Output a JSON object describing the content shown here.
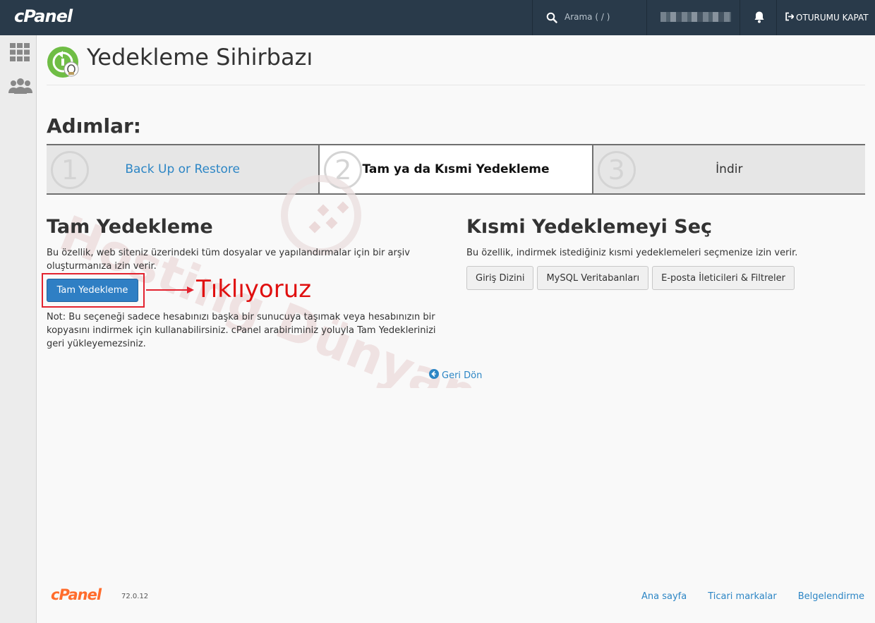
{
  "header": {
    "brand": "cPanel",
    "search_placeholder": "Arama ( / )",
    "logout_label": "OTURUMU KAPAT"
  },
  "page": {
    "title": "Yedekleme Sihirbazı",
    "steps_heading": "Adımlar:"
  },
  "steps": [
    {
      "number": "1",
      "label": "Back Up or Restore"
    },
    {
      "number": "2",
      "label": "Tam ya da Kısmi Yedekleme"
    },
    {
      "number": "3",
      "label": "İndir"
    }
  ],
  "full_backup": {
    "title": "Tam Yedekleme",
    "description": "Bu özellik, web siteniz üzerindeki tüm dosyalar ve yapılandırmalar için bir arşiv oluşturmanıza izin verir.",
    "button_label": "Tam Yedekleme",
    "annotation": "Tıklıyoruz",
    "note": "Not: Bu seçeneği sadece hesabınızı başka bir sunucuya taşımak veya hesabınızın bir kopyasını indirmek için kullanabilirsiniz. cPanel arabiriminiz yoluyla Tam Yedeklerinizi geri yükleyemezsiniz."
  },
  "partial_backup": {
    "title": "Kısmi Yedeklemeyi Seç",
    "description": "Bu özellik, indirmek istediğiniz kısmi yedeklemeleri seçmenize izin verir.",
    "buttons": [
      "Giriş Dizini",
      "MySQL Veritabanları",
      "E-posta İleticileri & Filtreler"
    ]
  },
  "go_back_label": "Geri Dön",
  "watermark": "Hosting Dünyam",
  "footer": {
    "brand": "cPanel",
    "version": "72.0.12",
    "links": [
      "Ana sayfa",
      "Ticari markalar",
      "Belgelendirme"
    ]
  },
  "colors": {
    "topbar": "#293a4a",
    "link": "#2d86c5",
    "primary_button": "#2f7fc4",
    "annotation_red": "#e01010",
    "brand_orange": "#ff6c2c"
  }
}
